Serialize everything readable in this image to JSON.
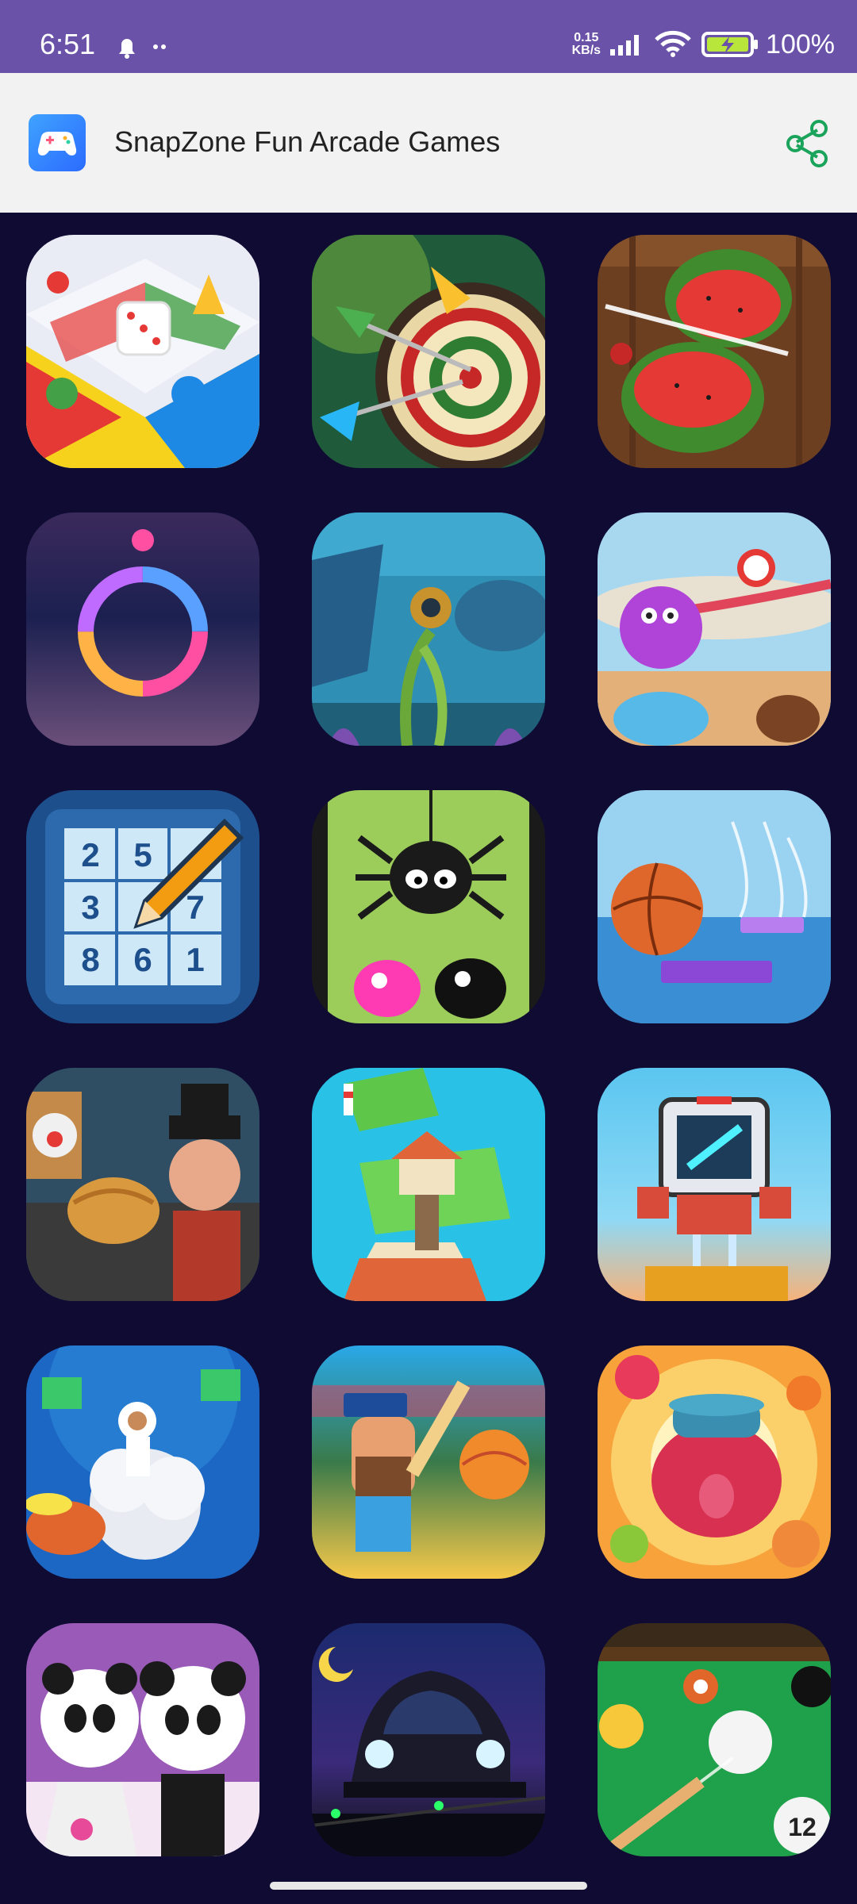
{
  "status_bar": {
    "time": "6:51",
    "net_speed_value": "0.15",
    "net_speed_unit": "KB/s",
    "battery": "100%",
    "icons": [
      "bell-icon",
      "dots-icon",
      "signal-icon",
      "wifi-icon",
      "battery-charging-icon"
    ]
  },
  "app_bar": {
    "title": "SnapZone Fun Arcade Games",
    "logo_icon": "gamepad-icon",
    "share_icon": "share-icon",
    "accent": "#1aa35a"
  },
  "games": [
    {
      "icon": "ludo-game-icon"
    },
    {
      "icon": "darts-game-icon"
    },
    {
      "icon": "fruit-slice-game-icon"
    },
    {
      "icon": "color-ring-game-icon"
    },
    {
      "icon": "underwater-diver-game-icon"
    },
    {
      "icon": "candy-monster-game-icon"
    },
    {
      "icon": "sudoku-game-icon"
    },
    {
      "icon": "spider-game-icon"
    },
    {
      "icon": "basketball-jump-game-icon"
    },
    {
      "icon": "pie-throw-game-icon"
    },
    {
      "icon": "island-tower-game-icon"
    },
    {
      "icon": "robot-jump-game-icon"
    },
    {
      "icon": "astronaut-runner-game-icon"
    },
    {
      "icon": "cricket-game-icon"
    },
    {
      "icon": "jam-fruit-game-icon"
    },
    {
      "icon": "panda-dressup-game-icon"
    },
    {
      "icon": "night-car-game-icon"
    },
    {
      "icon": "billiards-game-icon"
    }
  ],
  "sudoku_digits": [
    "2",
    "5",
    "3",
    "7",
    "8",
    "6",
    "1"
  ],
  "billiard_number": "12",
  "colors": {
    "status_bar": "#6a52a8",
    "app_bar": "#f2f2f2",
    "background": "#0f0b33"
  }
}
